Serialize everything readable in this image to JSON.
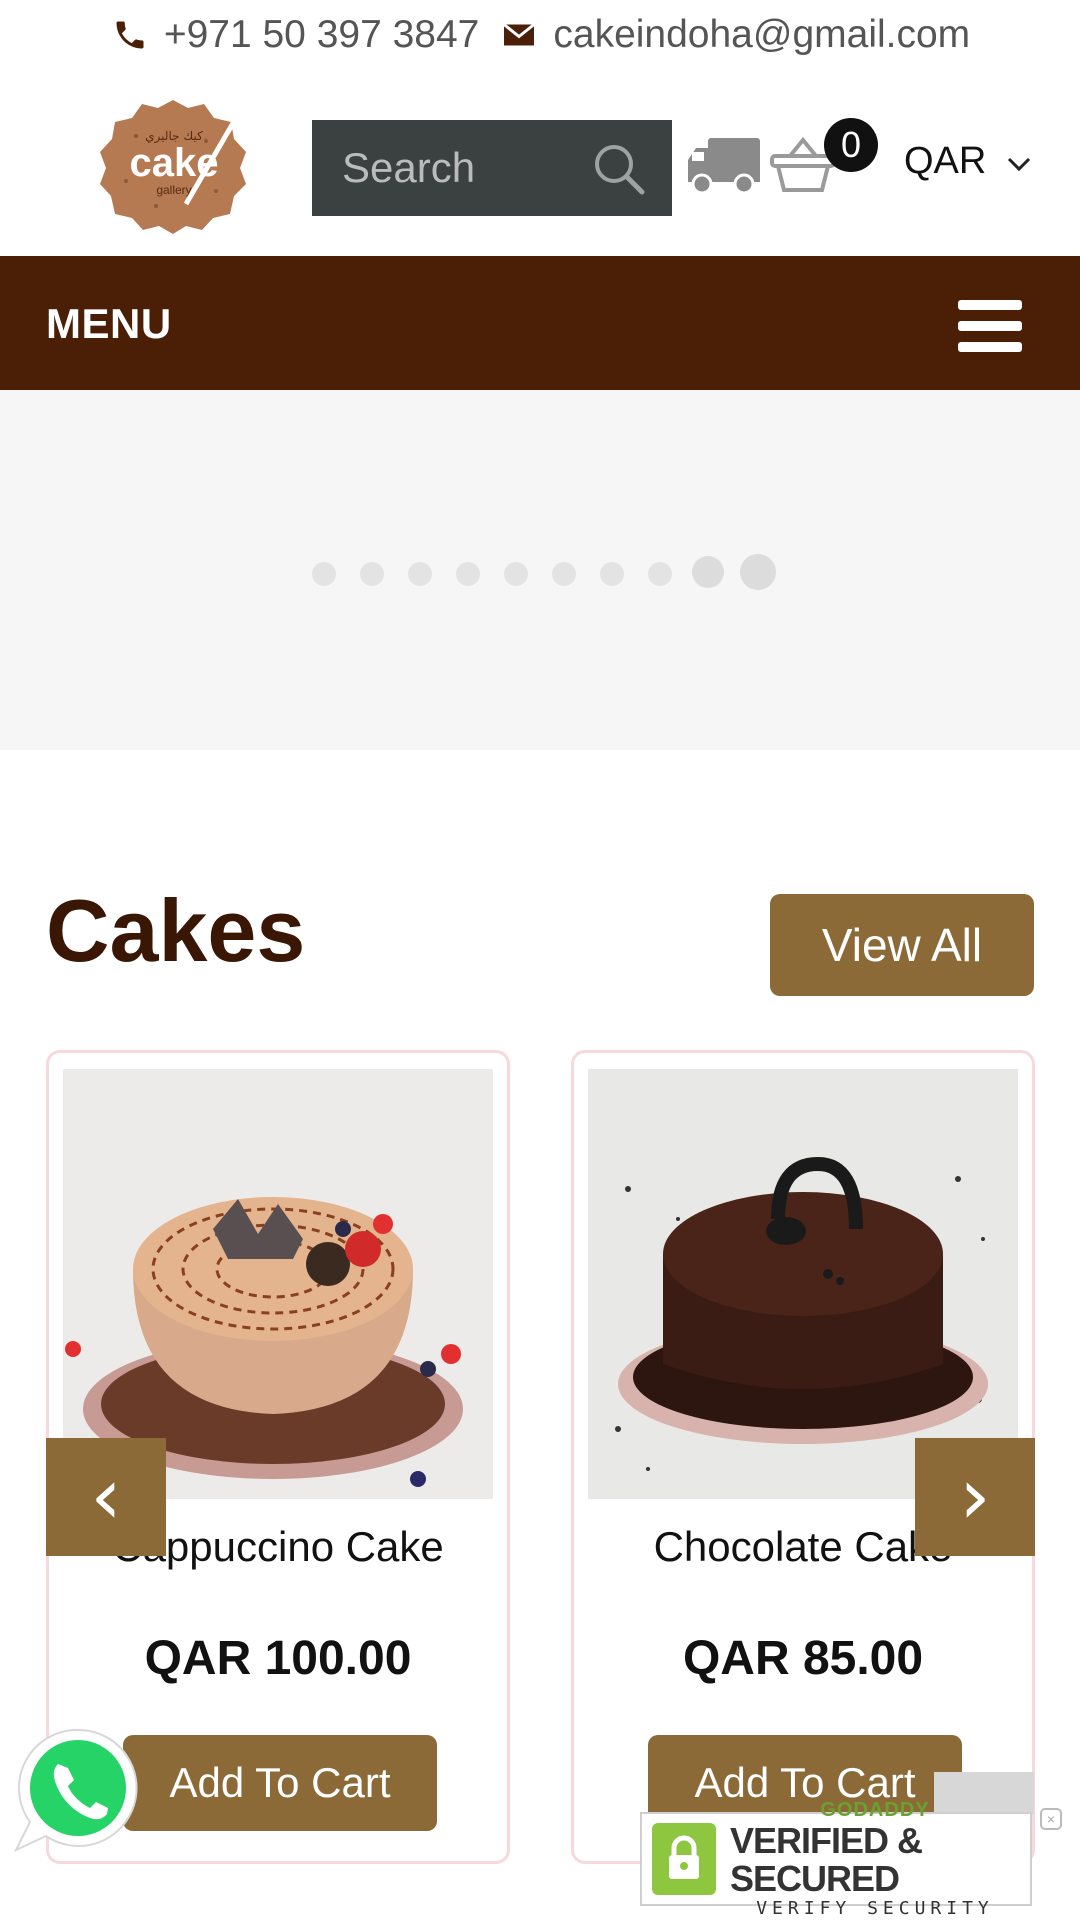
{
  "topbar": {
    "phone": "+971 50 397 3847",
    "email": "cakeindoha@gmail.com",
    "phone_icon": "phone-icon",
    "email_icon": "envelope-icon"
  },
  "header": {
    "logo": {
      "arabic": "كيك جاليري",
      "word": "cake",
      "sub": "gallery"
    },
    "search_placeholder": "Search",
    "cart_count": "0",
    "currency": "QAR"
  },
  "menubar": {
    "label": "MENU"
  },
  "slider": {
    "dot_count": 10,
    "active_dots": [
      8,
      9
    ]
  },
  "section": {
    "title": "Cakes",
    "view_all": "View All"
  },
  "products": [
    {
      "name": "Cappuccino Cake",
      "price": "QAR 100.00",
      "button": "Add To Cart"
    },
    {
      "name": "Chocolate Cake",
      "price": "QAR 85.00",
      "button": "Add To Cart"
    }
  ],
  "nav": {
    "prev": "‹",
    "next": "›"
  },
  "badge": {
    "line1": "GODADDY",
    "line2": "VERIFIED & SECURED",
    "line3": "VERIFY SECURITY"
  },
  "colors": {
    "brand_dark": "#4a1f05",
    "brand_gold": "#8c6a38",
    "search_bg": "#3b4140",
    "whatsapp": "#25d366"
  }
}
